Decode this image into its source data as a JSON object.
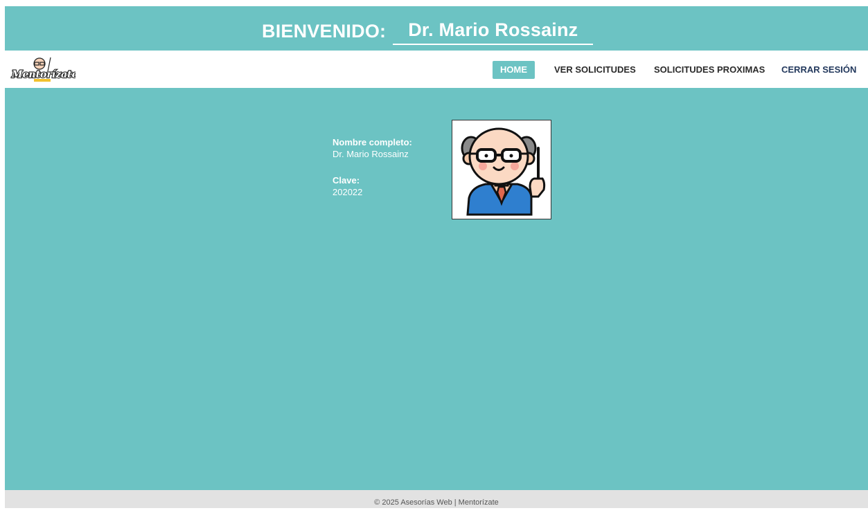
{
  "header": {
    "welcome_label": "BIENVENIDO:",
    "user_name": "Dr. Mario Rossainz"
  },
  "navbar": {
    "logo_text": "Mentorízate",
    "items": [
      {
        "label": "HOME",
        "active": true
      },
      {
        "label": "VER SOLICITUDES",
        "active": false
      },
      {
        "label": "SOLICITUDES PROXIMAS",
        "active": false
      },
      {
        "label": "CERRAR SESIÓN",
        "active": false
      }
    ]
  },
  "profile": {
    "name_label": "Nombre completo:",
    "name_value": "Dr. Mario Rossainz",
    "key_label": "Clave:",
    "key_value": "202022",
    "avatar_icon": "teacher-avatar-icon"
  },
  "footer": {
    "text": "© 2025 Asesorías Web | Mentorízate"
  },
  "colors": {
    "primary": "#6cc3c3",
    "nav_text": "#2a2a2a",
    "logout_text": "#23395d",
    "footer_bg": "#e2e2e2"
  }
}
